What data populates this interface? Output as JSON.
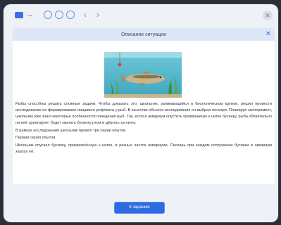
{
  "toolbar": {
    "icons": [
      "cards-icon",
      "arrow-right-icon",
      "circle-1-icon",
      "circle-2-icon",
      "circle-3-icon",
      "chevron-left-icon",
      "chevron-right-icon",
      "close-icon"
    ],
    "close_label": "✕"
  },
  "panel": {
    "title": "Описание ситуации",
    "close_label": "✕"
  },
  "text": {
    "p1": "Рыбы способны решать сложные задачи. Чтобы доказать это, школьник, занимающийся в биологическом кружке, решил провести исследование по формированию пищевого рефлекса у рыб. В качестве объекта исследования он выбрал пескаря. Планируя эксперимент, школьник уже знал некоторые особенности поведения рыб. Так, если в аквариум опустить привязанную к нитке бусинку, рыба обязательно на неё среагирует: будет хватать бусинку ртом и дёргать за нитку.",
    "p2": "В рамках исследования школьник провёл три серии опытов.",
    "p3": "Первая серия опытов.",
    "p4": "Школьник опускал бусинку, прикреплённую к нитке, в разных частях аквариума. Пескарь при каждом погружении бусинки в аквариум хватал её."
  },
  "buttons": {
    "to_task": "К заданию"
  },
  "colors": {
    "accent": "#2d6be2",
    "panel_header": "#dde7f7",
    "background": "#eef1f5"
  }
}
